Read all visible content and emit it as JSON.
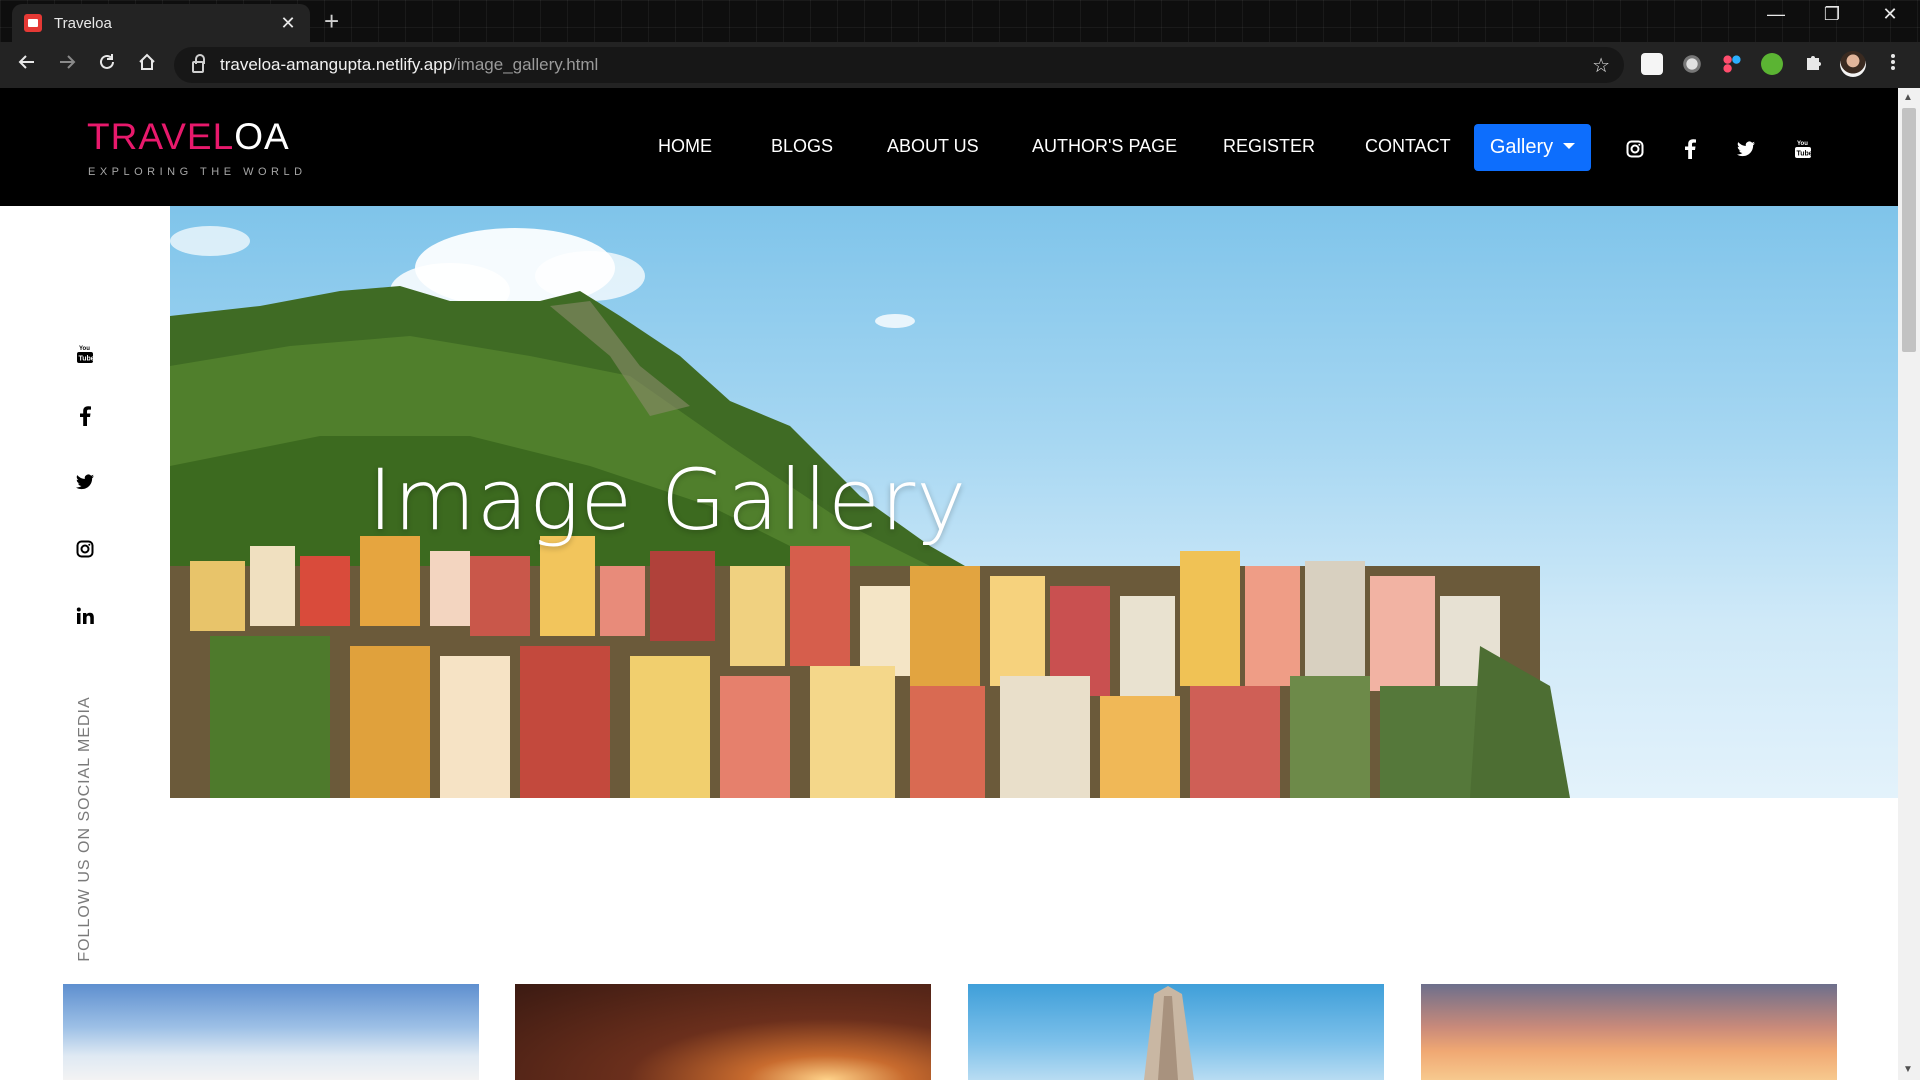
{
  "browser": {
    "tab_title": "Traveloa",
    "tab_close": "✕",
    "new_tab": "+",
    "url_host": "traveloa-amangupta.netlify.app",
    "url_path": "/image_gallery.html",
    "window_controls": [
      "—",
      "❐",
      "✕"
    ]
  },
  "site": {
    "logo_part1": "TRAVEL",
    "logo_part2": "OA",
    "tagline": "EXPLORING THE WORLD",
    "nav": [
      "HOME",
      "BLOGS",
      "ABOUT US",
      "AUTHOR'S PAGE",
      "REGISTER",
      "CONTACT"
    ],
    "gallery_button": "Gallery",
    "nav_social_icons": [
      "instagram-icon",
      "facebook-icon",
      "twitter-icon",
      "youtube-icon"
    ],
    "hero_title": "Image Gallery",
    "sidebar_icons": [
      "youtube-icon",
      "facebook-icon",
      "twitter-icon",
      "instagram-icon",
      "linkedin-icon"
    ],
    "follow_text": "FOLLOW US ON SOCIAL MEDIA"
  },
  "colors": {
    "brand_pink": "#e8196c",
    "button_blue": "#0d6efd",
    "navbar": "#000000"
  }
}
